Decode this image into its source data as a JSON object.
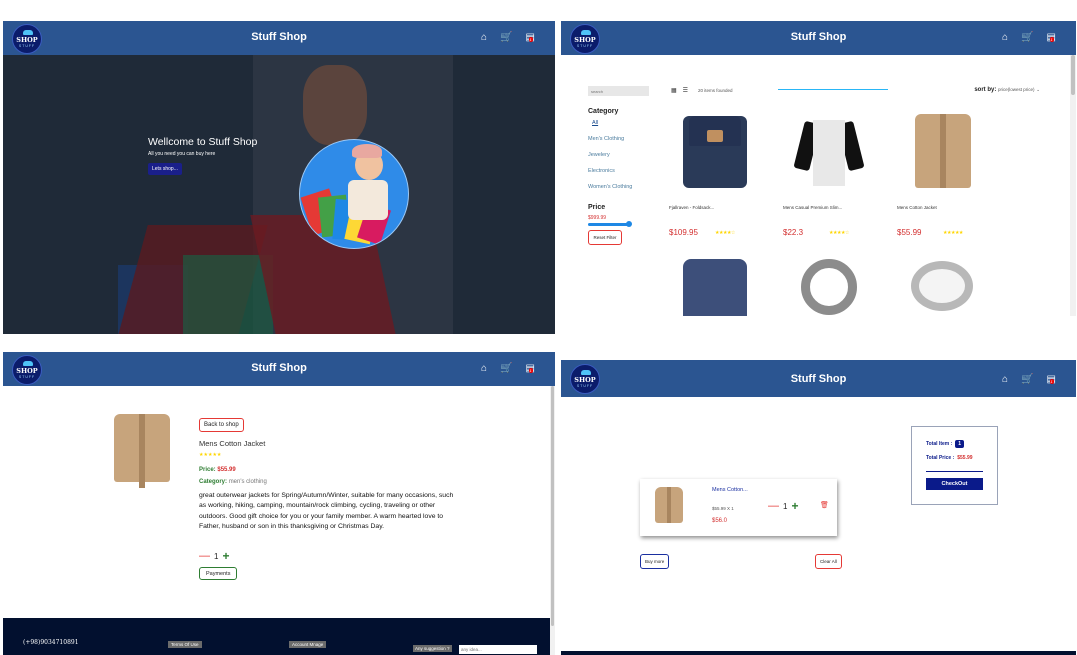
{
  "brand": {
    "title": "Stuff Shop",
    "logo_main": "SHOP",
    "logo_sub": "STUFF",
    "nav_icons": [
      "home-icon",
      "cart-icon",
      "basket-icon"
    ],
    "cart_badge": "1",
    "colors": {
      "navbar": "#2b5591",
      "price": "#d32f2f",
      "accent": "#0a1a8a",
      "stars": "#ffd600"
    }
  },
  "home": {
    "welcome": "Wellcome to Stuff Shop",
    "subtitle": "All you need you can buy here",
    "cta": "Lets shop..."
  },
  "shop": {
    "search_placeholder": "search",
    "count": "20 items founded",
    "sort_label": "sort by:",
    "sort_value": "price(lowest price)",
    "category_title": "Category",
    "categories": [
      "All",
      "Men's Clothing",
      "Jewelery",
      "Electronics",
      "Women's Clothing"
    ],
    "price_title": "Price",
    "price_max": "$999.99",
    "reset": "Reset Filter",
    "products": [
      {
        "name": "Fjallraven - Foldsack...",
        "price": "$109.95",
        "stars": "★★★★☆"
      },
      {
        "name": "Mens Casual Premium Slim...",
        "price": "$22.3",
        "stars": "★★★★☆"
      },
      {
        "name": "Mens Cotton Jacket",
        "price": "$55.99",
        "stars": "★★★★★"
      }
    ]
  },
  "detail": {
    "back": "Back to shop",
    "name": "Mens Cotton Jacket",
    "stars": "★★★★★",
    "price_label": "Price:",
    "price": "$55.99",
    "category_label": "Category:",
    "category": "men's clothing",
    "description": "great outerwear jackets for Spring/Autumn/Winter, suitable for many occasions, such as working, hiking, camping, mountain/rock climbing, cycling, traveling or other outdoors. Good gift choice for you or your family member. A warm hearted love to Father, husband or son in this thanksgiving or Christmas Day.",
    "qty": "1",
    "payments": "Payments"
  },
  "footer": {
    "phone": "(+98)9034710891",
    "terms": "Terms Of Use",
    "account": "Account Mnage",
    "suggestion": "Any suggestion ?",
    "idea_placeholder": "any idea..."
  },
  "cart": {
    "item_name": "Mens Cotton...",
    "item_unit": "$55.99 X 1",
    "item_total": "$56.0",
    "qty": "1",
    "total_item_label": "Total Item :",
    "total_item": "1",
    "total_price_label": "Total Price :",
    "total_price": "$55.99",
    "checkout": "CheckOut",
    "buy_more": "Buy more",
    "clear_all": "Clear All"
  }
}
